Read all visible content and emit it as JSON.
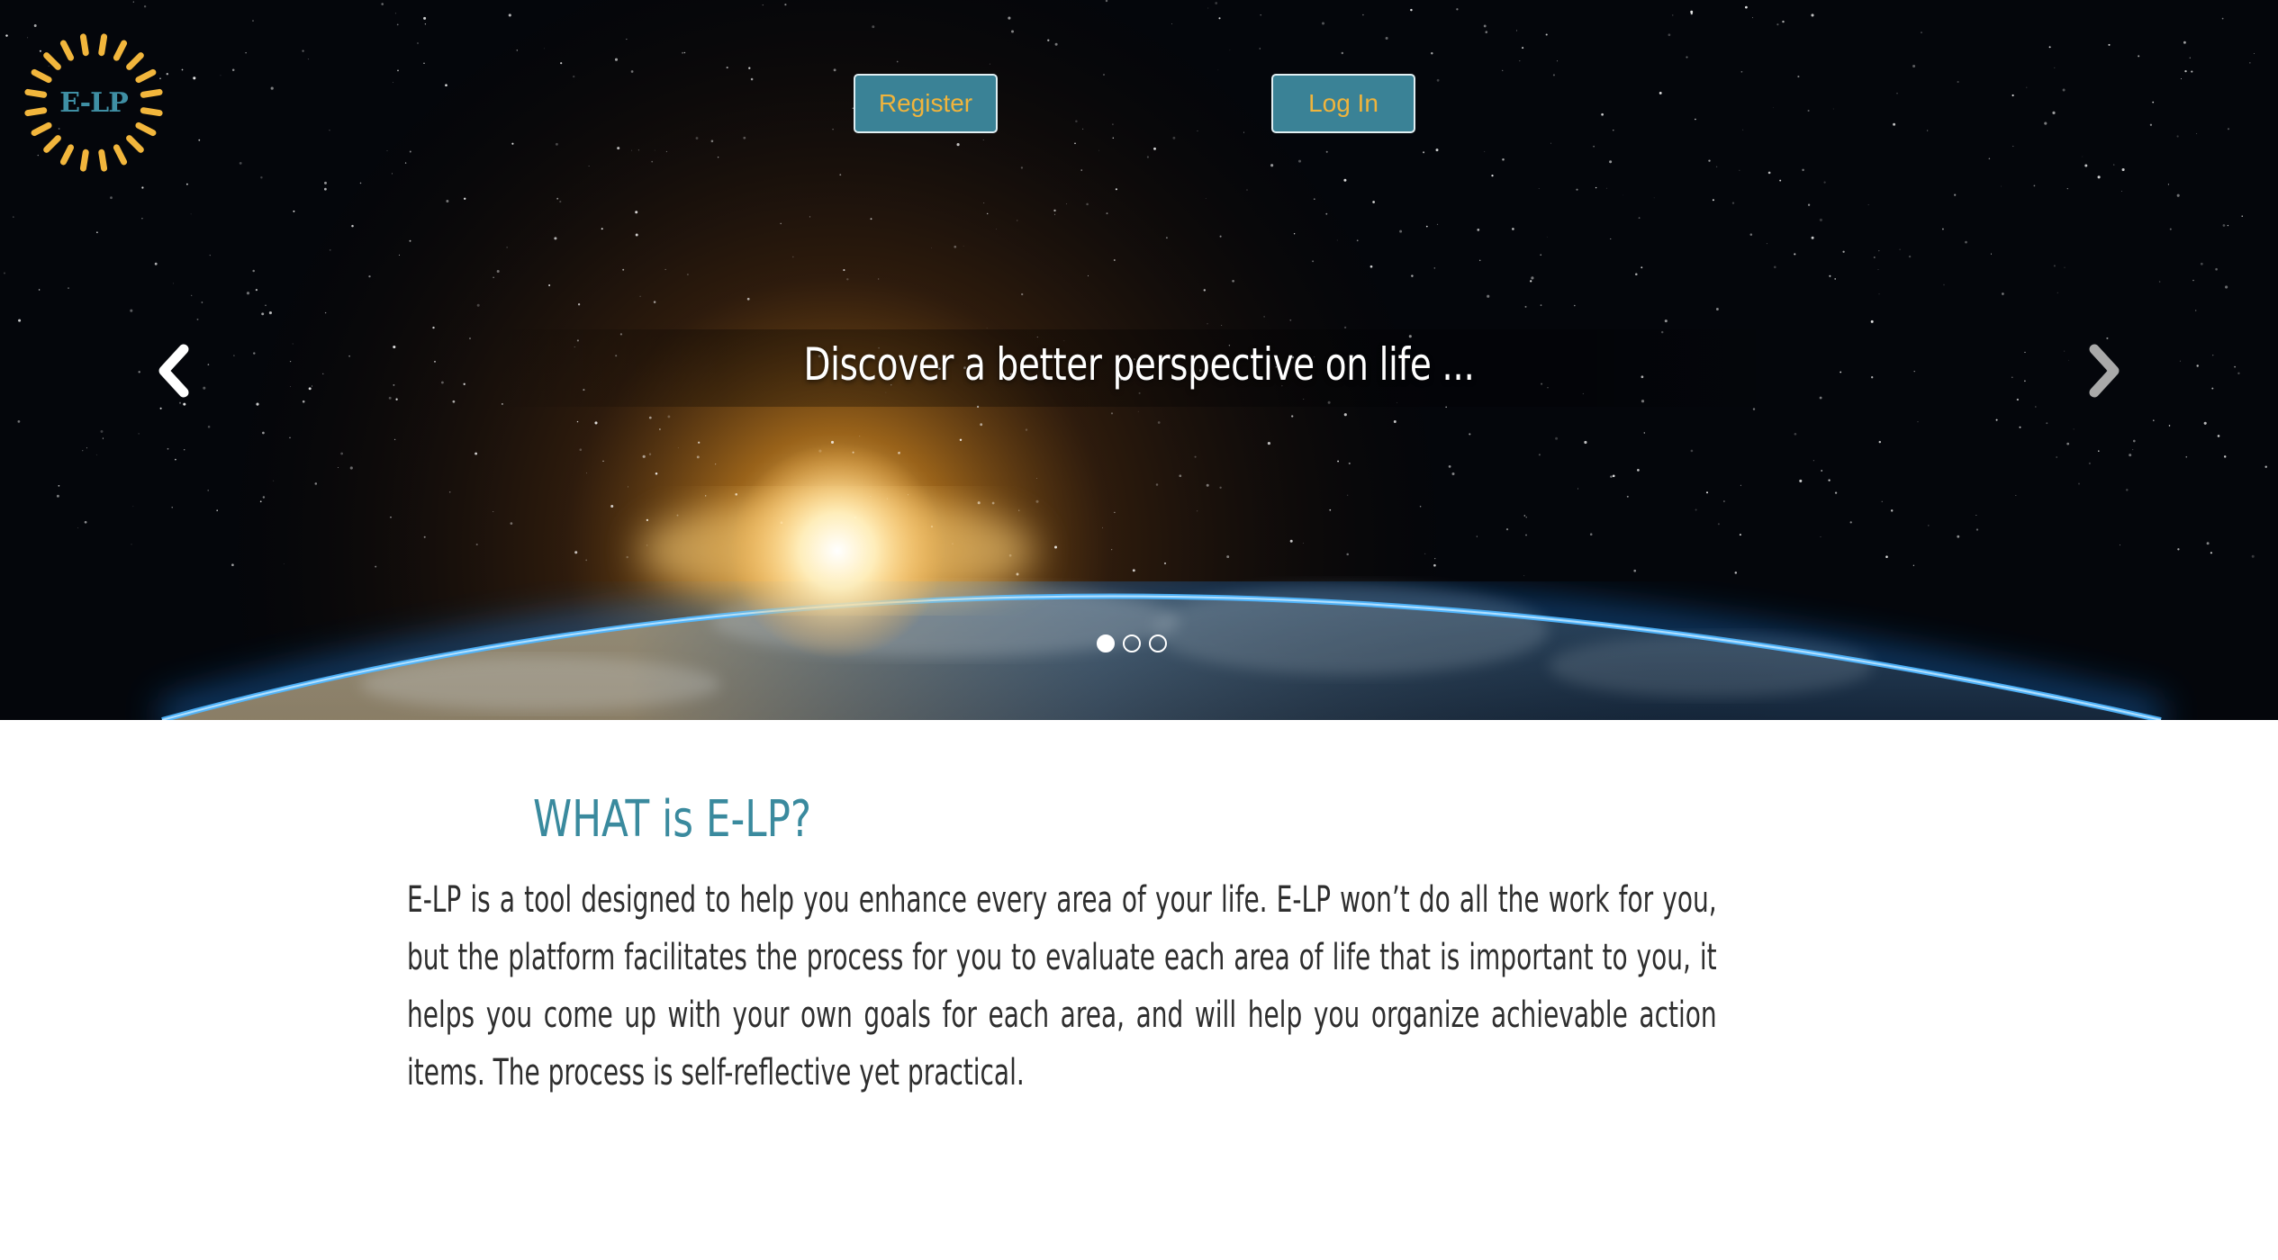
{
  "logo": {
    "text": "E-LP",
    "ray_color": "#f2b63c",
    "text_color": "#3f8fa4"
  },
  "nav": {
    "register_label": "Register",
    "login_label": "Log In",
    "button_bg": "#3a8296",
    "button_text_color": "#f0b43c"
  },
  "carousel": {
    "caption": "Discover a better perspective on life ...",
    "prev_icon": "chevron-left-icon",
    "next_icon": "chevron-right-icon",
    "slide_count": 3,
    "active_slide": 1
  },
  "about": {
    "heading": "WHAT is E-LP?",
    "body": "E-LP is a tool designed to help you enhance every area of your life. E-LP won’t do all the work for you, but the platform facilitates the process for you to evaluate each area of life that is important to you, it helps you come up with your own goals for each area, and will help you organize achievable action items. The process is self-reflective yet practical.",
    "heading_color": "#3a8a9e"
  }
}
